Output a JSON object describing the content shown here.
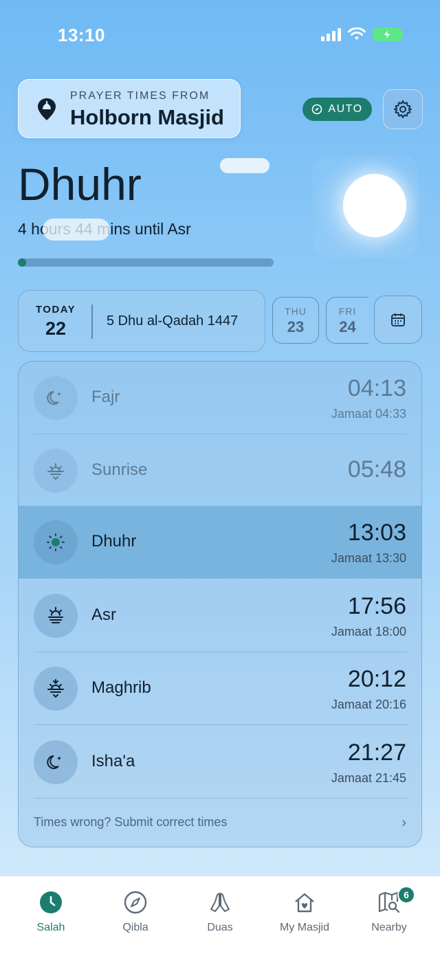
{
  "status_bar": {
    "time": "13:10"
  },
  "header": {
    "source_label": "PRAYER TIMES FROM",
    "masjid_name": "Holborn Masjid",
    "auto_label": "AUTO"
  },
  "current": {
    "prayer": "Dhuhr",
    "countdown": "4 hours 44 mins until Asr",
    "progress_fraction": 0.01
  },
  "dates": {
    "today_label": "TODAY",
    "today_num": "22",
    "hijri": "5 Dhu al-Qadah 1447",
    "next_days": [
      {
        "dow": "THU",
        "num": "23"
      },
      {
        "dow": "FRI",
        "num": "24"
      }
    ]
  },
  "prayers": [
    {
      "name": "Fajr",
      "time": "04:13",
      "jamaat": "Jamaat 04:33",
      "icon": "moon-star-icon",
      "state": "past"
    },
    {
      "name": "Sunrise",
      "time": "05:48",
      "jamaat": "",
      "icon": "sunrise-icon",
      "state": "past"
    },
    {
      "name": "Dhuhr",
      "time": "13:03",
      "jamaat": "Jamaat 13:30",
      "icon": "sun-icon",
      "state": "active"
    },
    {
      "name": "Asr",
      "time": "17:56",
      "jamaat": "Jamaat 18:00",
      "icon": "sun-horizon-icon",
      "state": "upcoming"
    },
    {
      "name": "Maghrib",
      "time": "20:12",
      "jamaat": "Jamaat 20:16",
      "icon": "sunset-icon",
      "state": "upcoming"
    },
    {
      "name": "Isha'a",
      "time": "21:27",
      "jamaat": "Jamaat 21:45",
      "icon": "moon-star-icon",
      "state": "upcoming"
    }
  ],
  "submit_link": "Times wrong? Submit correct times",
  "tabs": [
    {
      "label": "Salah",
      "icon": "clock-icon",
      "active": true
    },
    {
      "label": "Qibla",
      "icon": "compass-icon",
      "active": false
    },
    {
      "label": "Duas",
      "icon": "praying-hands-icon",
      "active": false
    },
    {
      "label": "My Masjid",
      "icon": "mosque-icon",
      "active": false
    },
    {
      "label": "Nearby",
      "icon": "map-search-icon",
      "active": false,
      "badge": "6"
    }
  ],
  "colors": {
    "accent": "#1c7d6e",
    "background_top": "#6fbaf5",
    "background_bottom": "#dceefc"
  }
}
